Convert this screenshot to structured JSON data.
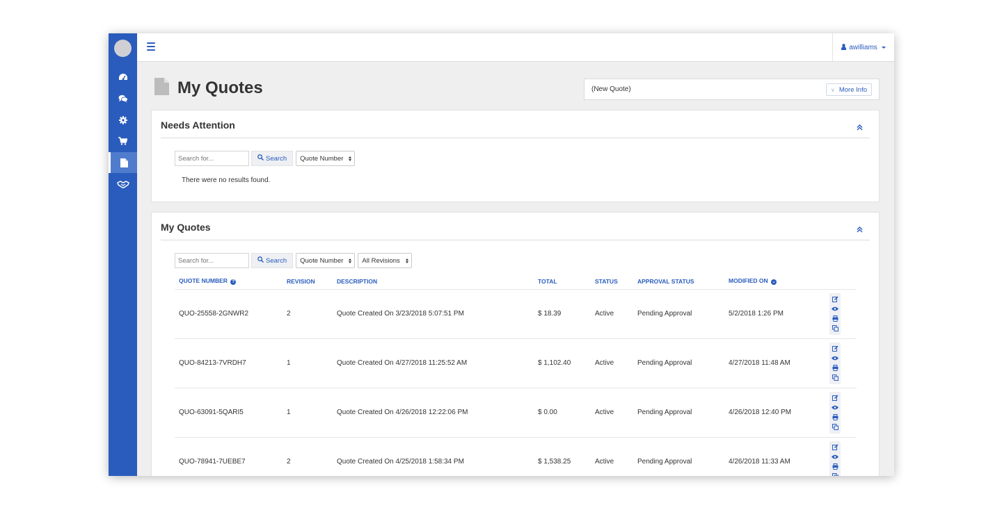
{
  "user": {
    "name": "awilliams"
  },
  "page": {
    "title": "My Quotes"
  },
  "new_quote": {
    "label": "(New Quote)",
    "more_info": "More Info"
  },
  "sidebar": {
    "items": [
      {
        "icon": "dashboard-icon"
      },
      {
        "icon": "chat-icon"
      },
      {
        "icon": "gear-icon"
      },
      {
        "icon": "cart-icon"
      },
      {
        "icon": "document-icon",
        "active": true
      },
      {
        "icon": "handshake-icon"
      }
    ]
  },
  "needs_attention": {
    "title": "Needs Attention",
    "search_placeholder": "Search for...",
    "search_label": "Search",
    "filter": "Quote Number",
    "empty_message": "There were no results found."
  },
  "my_quotes": {
    "title": "My Quotes",
    "search_placeholder": "Search for...",
    "search_label": "Search",
    "filter": "Quote Number",
    "revision_filter": "All Revisions",
    "columns": {
      "quote_number": "QUOTE NUMBER",
      "revision": "REVISION",
      "description": "DESCRIPTION",
      "total": "TOTAL",
      "status": "STATUS",
      "approval_status": "APPROVAL STATUS",
      "modified_on": "MODIFIED ON"
    },
    "rows": [
      {
        "quote_number": "QUO-25558-2GNWR2",
        "revision": "2",
        "description": "Quote Created On 3/23/2018 5:07:51 PM",
        "total": "$ 18.39",
        "status": "Active",
        "approval_status": "Pending Approval",
        "modified_on": "5/2/2018 1:26 PM"
      },
      {
        "quote_number": "QUO-84213-7VRDH7",
        "revision": "1",
        "description": "Quote Created On 4/27/2018 11:25:52 AM",
        "total": "$ 1,102.40",
        "status": "Active",
        "approval_status": "Pending Approval",
        "modified_on": "4/27/2018 11:48 AM"
      },
      {
        "quote_number": "QUO-63091-5QARI5",
        "revision": "1",
        "description": "Quote Created On 4/26/2018 12:22:06 PM",
        "total": "$ 0.00",
        "status": "Active",
        "approval_status": "Pending Approval",
        "modified_on": "4/26/2018 12:40 PM"
      },
      {
        "quote_number": "QUO-78941-7UEBE7",
        "revision": "2",
        "description": "Quote Created On 4/25/2018 1:58:34 PM",
        "total": "$ 1,538.25",
        "status": "Active",
        "approval_status": "Pending Approval",
        "modified_on": "4/26/2018 11:33 AM"
      }
    ]
  },
  "colors": {
    "brand": "#2a5cbd",
    "sidebar_active": "#4f7ccc",
    "background": "#efefef"
  }
}
